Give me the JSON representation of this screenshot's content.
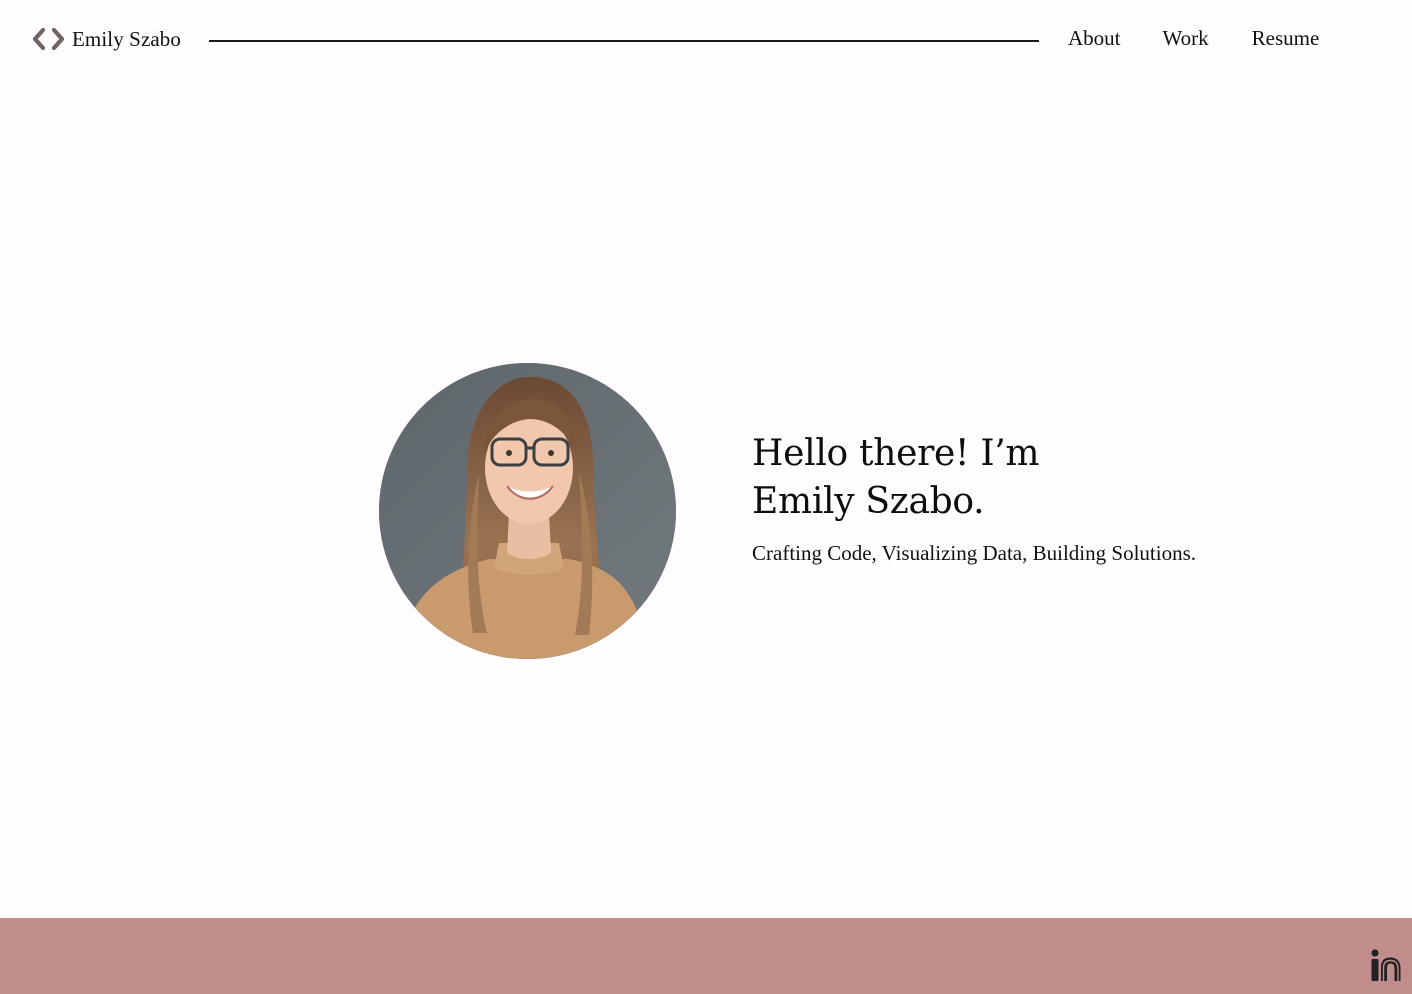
{
  "header": {
    "site_name": "Emily Szabo",
    "logo_icon": "code-brackets-icon",
    "nav": {
      "about_label": "About",
      "work_label": "Work",
      "resume_label": "Resume"
    }
  },
  "hero": {
    "title_line1": "Hello there! I’m",
    "title_line2": "Emily Szabo.",
    "subtitle": "Crafting Code, Visualizing Data, Building Solutions.",
    "portrait_alt": "Portrait of Emily Szabo"
  },
  "footer": {
    "social_icon": "linkedin-icon"
  },
  "colors": {
    "background": "#fffdfd",
    "footer": "#c08d8c",
    "logo_accent": "#6f6462"
  }
}
